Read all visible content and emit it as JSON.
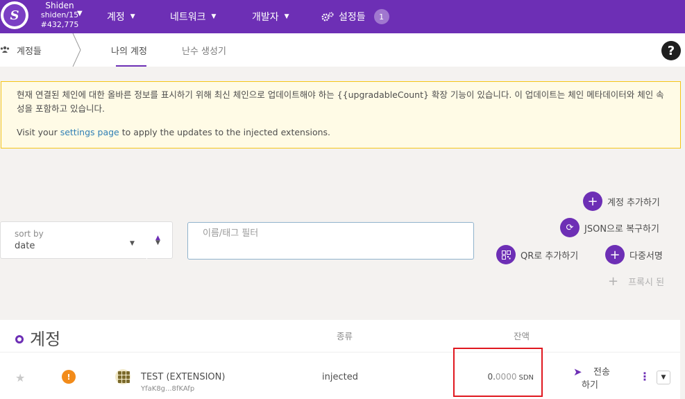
{
  "topbar": {
    "chain_name": "Shiden",
    "chain_spec": "shiden/15",
    "block_number": "#432,775",
    "nav": [
      "계정",
      "네트워크",
      "개발자"
    ],
    "settings_label": "설정들",
    "settings_badge": "1"
  },
  "subbar": {
    "crumb": "계정들",
    "tabs": [
      "나의 계정",
      "난수 생성기"
    ]
  },
  "banner": {
    "line1": "현재 연결된 체인에 대한 올바른 정보를 표시하기 위해 최신 체인으로 업데이트해야 하는 {{upgradableCount} 확장 기능이 있습니다. 이 업데이트는 체인 메타데이터와 체인 속성을 포함하고 있습니다.",
    "line2_prefix": "Visit your ",
    "line2_link": "settings page",
    "line2_suffix": " to apply the updates to the injected extensions."
  },
  "actions": {
    "add_account": "계정 추가하기",
    "restore_json": "JSON으로 복구하기",
    "add_qr": "QR로 추가하기",
    "multisig": "다중서명",
    "proxied": "프록시 된"
  },
  "sort": {
    "label": "sort by",
    "value": "date"
  },
  "filter": {
    "placeholder": "이름/태그 필터"
  },
  "table": {
    "title": "계정",
    "col_type": "종류",
    "col_balance": "잔액",
    "rows": [
      {
        "name": "TEST (EXTENSION)",
        "address": "YfaK8g...8fKAfp",
        "type": "injected",
        "balance_int": "0.",
        "balance_dec": "0000",
        "balance_unit": "SDN",
        "send_l1": "전송",
        "send_l2": "하기"
      }
    ]
  }
}
